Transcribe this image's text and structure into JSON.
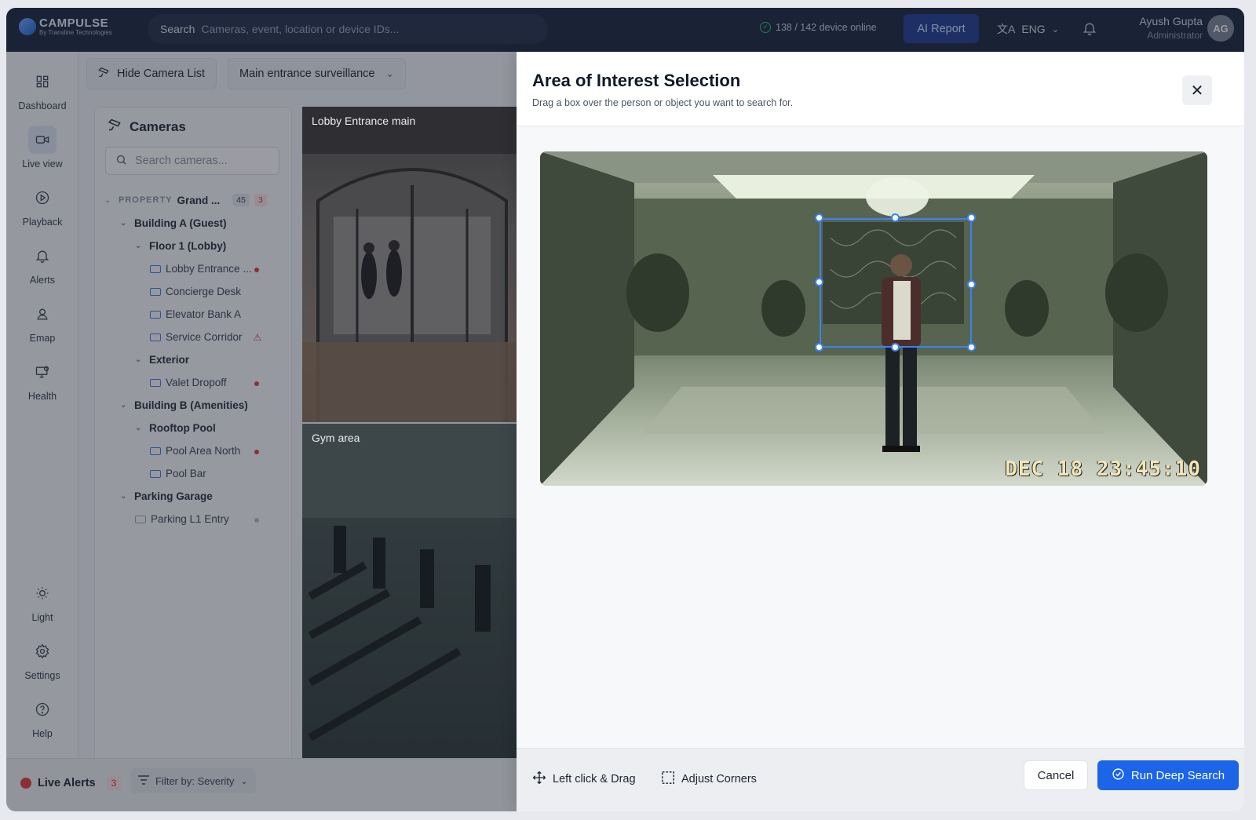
{
  "brand": {
    "name": "CAMPULSE",
    "tagline": "By Transline Technologies"
  },
  "topbar": {
    "search_label": "Search",
    "search_placeholder": "Cameras, event, location or device IDs...",
    "device_status": "138 / 142 device online",
    "ai_report": "AI Report",
    "language": "ENG",
    "user_name": "Ayush Gupta",
    "user_role": "Administrator",
    "user_initials": "AG"
  },
  "sidebar": {
    "items": [
      {
        "label": "Dashboard",
        "icon": "dashboard-icon"
      },
      {
        "label": "Live view",
        "icon": "video-camera-icon",
        "active": true
      },
      {
        "label": "Playback",
        "icon": "play-circle-icon"
      },
      {
        "label": "Alerts",
        "icon": "bell-icon"
      },
      {
        "label": "Emap",
        "icon": "map-pin-icon"
      },
      {
        "label": "Health",
        "icon": "monitor-health-icon"
      },
      {
        "label": "Light",
        "icon": "sun-icon"
      },
      {
        "label": "Settings",
        "icon": "gear-icon"
      },
      {
        "label": "Help",
        "icon": "help-icon"
      }
    ]
  },
  "toolbar": {
    "hide_camera_list": "Hide Camera List",
    "view_select": "Main entrance surveillance"
  },
  "cameras_panel": {
    "title": "Cameras",
    "search_placeholder": "Search cameras...",
    "property_tag": "PROPERTY",
    "property_name": "Grand ...",
    "property_count": "45",
    "property_alerts": "3",
    "tree": [
      {
        "label": "Building A (Guest)",
        "type": "group",
        "level": 1
      },
      {
        "label": "Floor 1 (Lobby)",
        "type": "group",
        "level": 2
      },
      {
        "label": "Lobby Entrance ...",
        "type": "camera",
        "level": 3,
        "status": "alert"
      },
      {
        "label": "Concierge Desk",
        "type": "camera",
        "level": 3,
        "status": "ok"
      },
      {
        "label": "Elevator Bank A",
        "type": "camera",
        "level": 3,
        "status": "ok"
      },
      {
        "label": "Service Corridor",
        "type": "camera",
        "level": 3,
        "status": "warning"
      },
      {
        "label": "Exterior",
        "type": "group",
        "level": 2
      },
      {
        "label": "Valet Dropoff",
        "type": "camera",
        "level": 3,
        "status": "alert"
      },
      {
        "label": "Building B (Amenities)",
        "type": "group",
        "level": 1
      },
      {
        "label": "Rooftop Pool",
        "type": "group",
        "level": 2
      },
      {
        "label": "Pool Area North",
        "type": "camera",
        "level": 3,
        "status": "alert"
      },
      {
        "label": "Pool Bar",
        "type": "camera",
        "level": 3,
        "status": "ok"
      },
      {
        "label": "Parking Garage",
        "type": "group",
        "level": 1
      },
      {
        "label": "Parking L1 Entry",
        "type": "camera",
        "level": 2,
        "status": "offline"
      }
    ]
  },
  "feeds": {
    "lobby": "Lobby Entrance main",
    "gym": "Gym area"
  },
  "bottombar": {
    "live_alerts": "Live Alerts",
    "live_alerts_count": "3",
    "filter": "Filter by: Severity"
  },
  "modal": {
    "title": "Area of Interest Selection",
    "subtitle": "Drag a box over the person or object you want to search for.",
    "timestamp": "DEC 18 23:45:10",
    "tool_drag": "Left click & Drag",
    "tool_corners": "Adjust Corners",
    "cancel": "Cancel",
    "run": "Run Deep Search"
  },
  "colors": {
    "accent": "#1c64e8",
    "selection": "#3b82f6",
    "alert": "#e03a3a",
    "topbar": "#17233a"
  }
}
